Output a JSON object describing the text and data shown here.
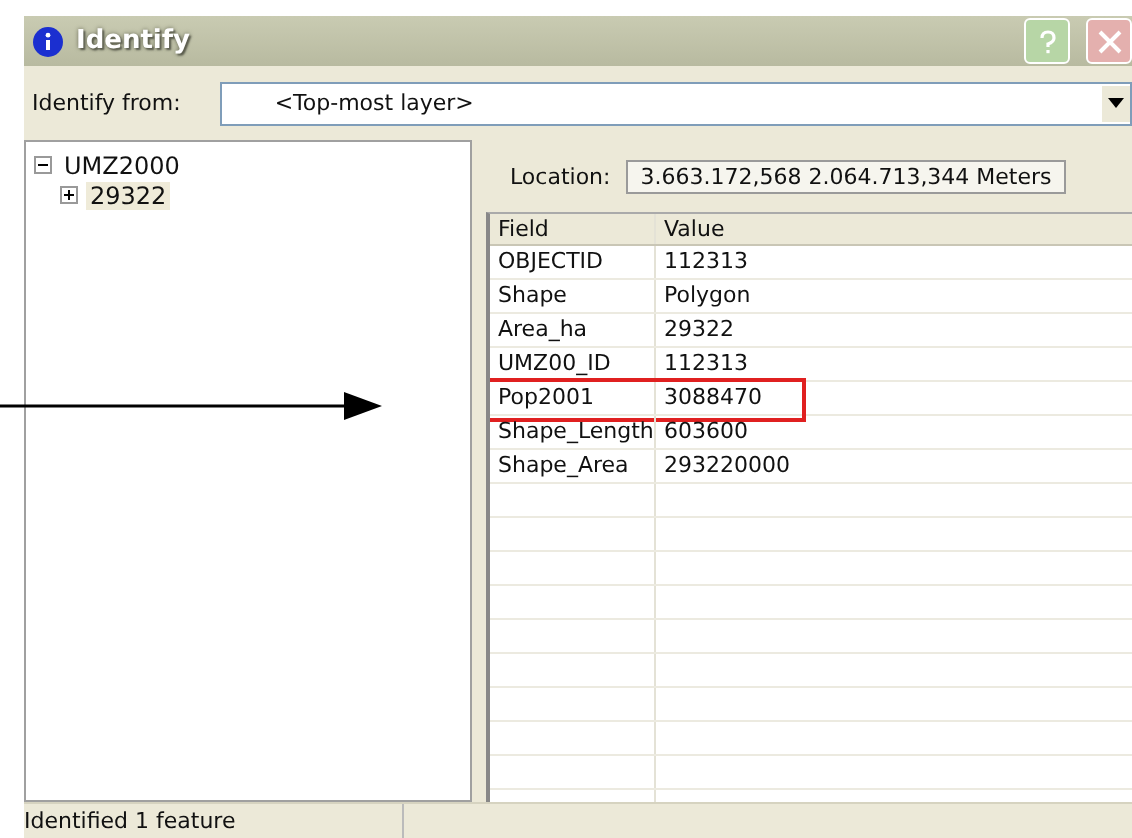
{
  "window": {
    "title": "Identify"
  },
  "identify_from": {
    "label": "Identify from:",
    "value": "<Top-most layer>"
  },
  "tree": [
    {
      "label": "UMZ2000",
      "expanded": true,
      "selected": false,
      "children": [
        {
          "label": "29322",
          "expanded": false,
          "selected": true
        }
      ]
    }
  ],
  "location": {
    "label": "Location:",
    "value": "3.663.172,568  2.064.713,344 Meters"
  },
  "table": {
    "columns": [
      "Field",
      "Value"
    ],
    "rows": [
      {
        "field": "OBJECTID",
        "value": "112313",
        "highlighted": false
      },
      {
        "field": "Shape",
        "value": "Polygon",
        "highlighted": false
      },
      {
        "field": "Area_ha",
        "value": "29322",
        "highlighted": false
      },
      {
        "field": "UMZ00_ID",
        "value": "112313",
        "highlighted": false
      },
      {
        "field": "Pop2001",
        "value": "3088470",
        "highlighted": true
      },
      {
        "field": "Shape_Length",
        "value": "603600",
        "highlighted": false
      },
      {
        "field": "Shape_Area",
        "value": "293220000",
        "highlighted": false
      }
    ]
  },
  "status_bar": "Identified 1 feature"
}
